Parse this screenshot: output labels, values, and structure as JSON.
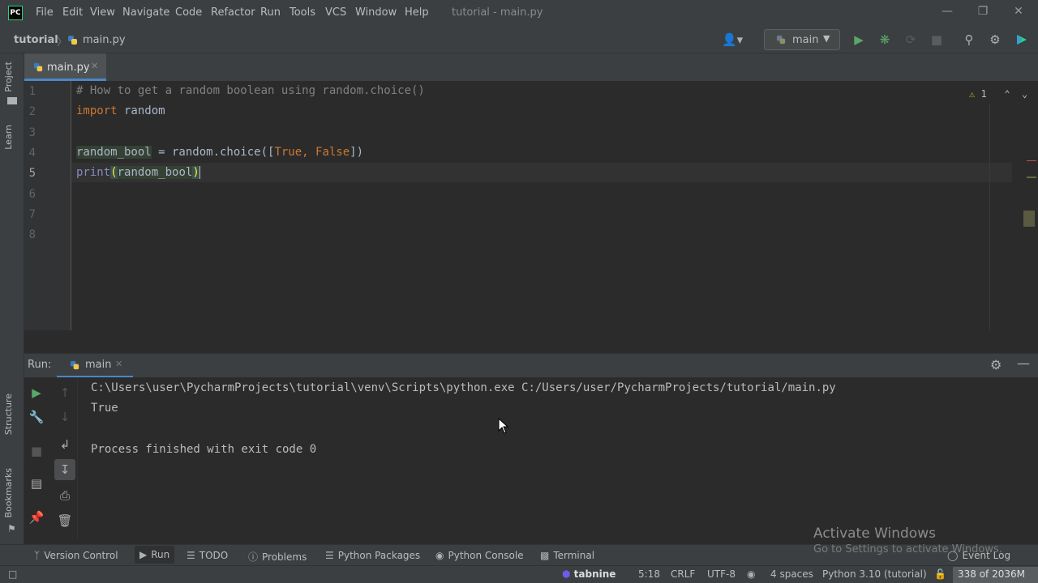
{
  "menubar": {
    "logo": "PC",
    "items": [
      "File",
      "Edit",
      "View",
      "Navigate",
      "Code",
      "Refactor",
      "Run",
      "Tools",
      "VCS",
      "Window",
      "Help"
    ],
    "window_title": "tutorial - main.py",
    "controls": [
      "—",
      "❐",
      "✕"
    ]
  },
  "navbar": {
    "project": "tutorial",
    "separator": "〉",
    "file": "main.py",
    "run_config": "main"
  },
  "left_strip": {
    "project": "Project",
    "learn": "Learn",
    "structure": "Structure",
    "bookmarks": "Bookmarks"
  },
  "editor": {
    "tab_label": "main.py",
    "warnings": "1",
    "line_numbers": [
      "1",
      "2",
      "3",
      "4",
      "5",
      "6",
      "7",
      "8"
    ],
    "current_line": "5",
    "line1": "# How to get a random boolean using random.choice()",
    "line2_kw": "import",
    "line2_rest": " random",
    "line4_var": "random_bool",
    "line4_mid": " = random.choice([",
    "line4_true": "True",
    "line4_comma": ", ",
    "line4_false": "False",
    "line4_end": "])",
    "line5_fn": "print",
    "line5_open": "(",
    "line5_arg": "random_bool",
    "line5_close": ")"
  },
  "run_panel": {
    "title": "Run:",
    "tab_label": "main",
    "console": [
      "C:\\Users\\user\\PycharmProjects\\tutorial\\venv\\Scripts\\python.exe C:/Users/user/PycharmProjects/tutorial/main.py",
      "True",
      "",
      "Process finished with exit code 0"
    ]
  },
  "bottom_tabs": {
    "version_control": "Version Control",
    "run": "Run",
    "todo": "TODO",
    "problems": "Problems",
    "python_packages": "Python Packages",
    "python_console": "Python Console",
    "terminal": "Terminal",
    "event_log": "Event Log"
  },
  "statusbar": {
    "tabnine": "tabnine",
    "position": "5:18",
    "line_sep": "CRLF",
    "encoding": "UTF-8",
    "indent": "4 spaces",
    "interpreter": "Python 3.10 (tutorial)",
    "memory": "338 of 2036M"
  },
  "watermark": {
    "title": "Activate Windows",
    "subtitle": "Go to Settings to activate Windows."
  },
  "colors": {
    "accent": "#4a88c7",
    "run_green": "#59a869",
    "keyword": "#cc7832",
    "comment": "#808080",
    "builtin": "#8888c6"
  }
}
